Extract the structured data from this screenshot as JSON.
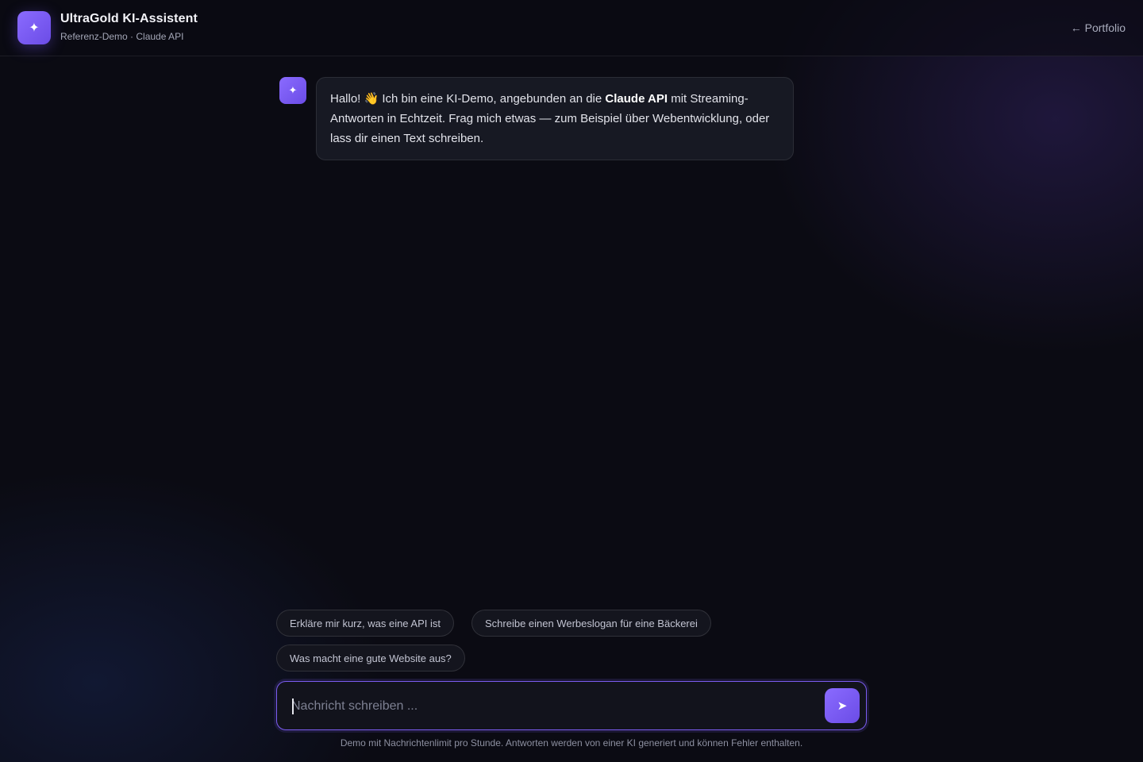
{
  "header": {
    "logo_icon": "✦",
    "title": "UltraGold KI-Assistent",
    "subtitle": "Referenz-Demo · Claude API",
    "portfolio_link": "← Portfolio"
  },
  "chat": {
    "messages": [
      {
        "role": "assistant",
        "avatar_icon": "✦",
        "text_before": "Hallo! 👋 Ich bin eine KI-Demo, angebunden an die ",
        "text_bold": "Claude API",
        "text_after": " mit Streaming-Antworten in Echtzeit. Frag mich etwas — zum Beispiel über Webentwicklung, oder lass dir einen Text schreiben."
      }
    ]
  },
  "suggestions": [
    "Erkläre mir kurz, was eine API ist",
    "Schreibe einen Werbeslogan für eine Bäckerei",
    "Was macht eine gute Website aus?"
  ],
  "composer": {
    "value": "",
    "placeholder": "Nachricht schreiben ...",
    "send_icon": "➤"
  },
  "footer": {
    "disclaimer": "Demo mit Nachrichtenlimit pro Stunde. Antworten werden von einer KI generiert und können Fehler enthalten."
  },
  "colors": {
    "accent": "#7b5cf0",
    "background": "#0b0b13",
    "bubble": "#171923"
  }
}
